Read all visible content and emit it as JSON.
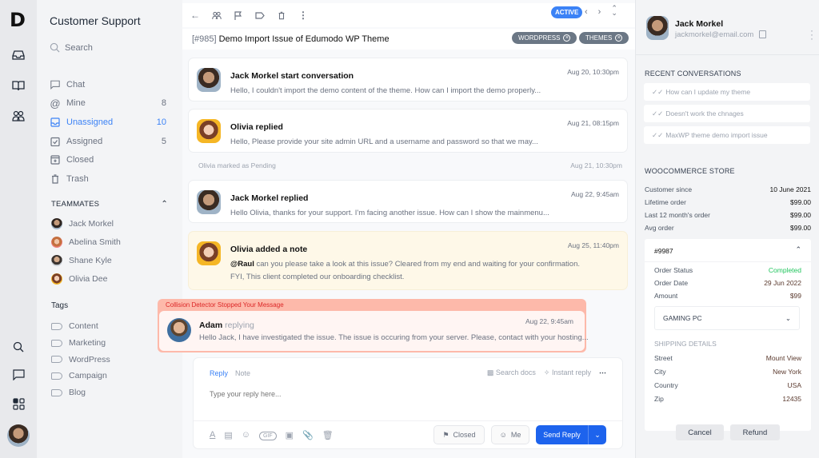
{
  "app": {
    "logo": "D"
  },
  "rail": {
    "icons": [
      "inbox-icon",
      "book-icon",
      "team-icon",
      "search-icon",
      "chat-icon",
      "apps-icon"
    ]
  },
  "sidebar": {
    "title": "Customer Support",
    "search_label": "Search",
    "nav": [
      {
        "label": "Chat",
        "count": "",
        "icon": "chat-icon"
      },
      {
        "label": "Mine",
        "count": "8",
        "icon": "at-icon"
      },
      {
        "label": "Unassigned",
        "count": "10",
        "icon": "inbox-icon",
        "active": true
      },
      {
        "label": "Assigned",
        "count": "5",
        "icon": "check-icon"
      },
      {
        "label": "Closed",
        "count": "",
        "icon": "archive-icon"
      },
      {
        "label": "Trash",
        "count": "",
        "icon": "trash-icon"
      }
    ],
    "teammates_header": "TEAMMATES",
    "teammates": [
      "Jack Morkel",
      "Abelina Smith",
      "Shane Kyle",
      "Olivia Dee"
    ],
    "tags_header": "Tags",
    "tags": [
      "Content",
      "Marketing",
      "WordPress",
      "Campaign",
      "Blog"
    ]
  },
  "conversation": {
    "status": "ACTIVE",
    "ticket_number": "[#985]",
    "subject": "Demo Import Issue of Edumodo WP Theme",
    "chips": [
      "WORDPRESS",
      "THEMES"
    ],
    "messages": [
      {
        "title": "Jack Morkel start conversation",
        "text": "Hello, I couldn't import the demo content of the theme. How can I import the demo properly...",
        "time": "Aug 20, 10:30pm"
      },
      {
        "title": "Olivia replied",
        "text": "Hello, Please provide your site admin URL and a username and password so that we may...",
        "time": "Aug 21, 08:15pm"
      },
      {
        "title": "Jack Morkel replied",
        "text": "Hello Olivia, thanks for your support. I'm facing another issue. How can I show the mainmenu...",
        "time": "Aug 22, 9:45am"
      },
      {
        "title": "Olivia added a note",
        "mention": "@Raul",
        "text": " can you please take a look at this issue? Cleared from my end and waiting for your confirmation.",
        "text2": "FYI, This client completed our onboarding checklist.",
        "time": "Aug 25, 11:40pm"
      }
    ],
    "system_event": {
      "text": "Olivia marked as Pending",
      "time": "Aug 21, 10:30pm"
    },
    "collision": {
      "header": "Collision Detector Stopped Your Message",
      "name": "Adam",
      "status": "replying",
      "text": "Hello Jack, I have investigated the issue. The issue is occuring from your server. Please, contact with your hosting...",
      "time": "Aug 22, 9:45am"
    },
    "composer": {
      "tab_reply": "Reply",
      "tab_note": "Note",
      "search_docs": "Search docs",
      "instant_reply": "Instant reply",
      "placeholder": "Type your reply here...",
      "status_button": "Closed",
      "assign_button": "Me",
      "send_button": "Send Reply"
    }
  },
  "customer": {
    "name": "Jack Morkel",
    "email": "jackmorkel@email.com",
    "recent_header": "RECENT CONVERSATIONS",
    "recent": [
      "How can I update my theme",
      "Doesn't work the chnages",
      "MaxWP theme demo import issue"
    ],
    "store_header": "WOOCOMMERCE STORE",
    "store": [
      {
        "k": "Customer since",
        "v": "10 June 2021"
      },
      {
        "k": "Lifetime order",
        "v": "$99.00"
      },
      {
        "k": "Last 12 month's order",
        "v": "$99.00"
      },
      {
        "k": "Avg order",
        "v": "$99.00"
      }
    ],
    "order": {
      "id": "#9987",
      "status_label": "Order Status",
      "status": "Completed",
      "date_label": "Order Date",
      "date": "29 Jun 2022",
      "amount_label": "Amount",
      "amount": "$99",
      "product": "GAMING PC",
      "shipping_header": "SHIPPING DETAILS",
      "shipping": [
        {
          "k": "Street",
          "v": "Mount View"
        },
        {
          "k": "City",
          "v": "New York"
        },
        {
          "k": "Country",
          "v": "USA"
        },
        {
          "k": "Zip",
          "v": "12435"
        }
      ]
    },
    "cancel_button": "Cancel",
    "refund_button": "Refund"
  },
  "colors": {
    "accent": "#3b82f6",
    "send": "#1d63ed",
    "completed": "#22c55e",
    "note_bg": "#fef8e8",
    "collision": "#fdb9aa"
  }
}
